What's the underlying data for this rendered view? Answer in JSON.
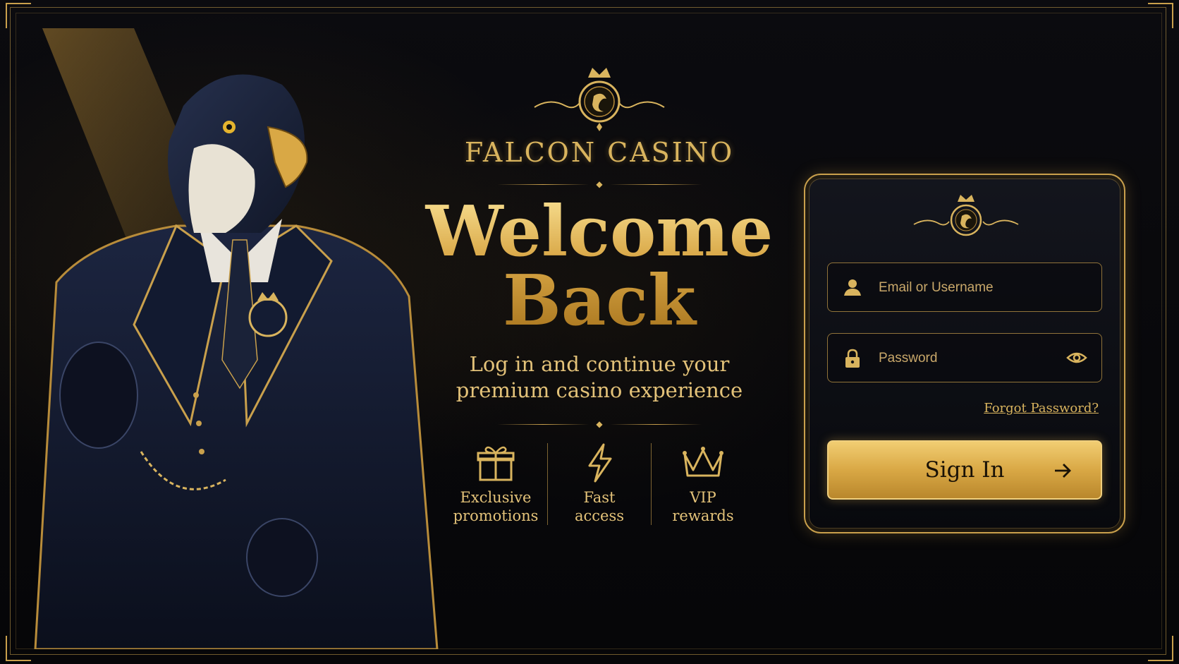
{
  "brand": {
    "name": "FALCON CASINO"
  },
  "hero": {
    "title_line1": "Welcome",
    "title_line2": "Back",
    "subtitle_line1": "Log in and continue your",
    "subtitle_line2": "premium casino experience"
  },
  "features": [
    {
      "icon": "gift-icon",
      "line1": "Exclusive",
      "line2": "promotions"
    },
    {
      "icon": "lightning-icon",
      "line1": "Fast",
      "line2": "access"
    },
    {
      "icon": "crown-icon",
      "line1": "VIP",
      "line2": "rewards"
    }
  ],
  "login": {
    "email_placeholder": "Email or Username",
    "password_placeholder": "Password",
    "forgot_label": "Forgot Password?",
    "signin_label": "Sign In"
  },
  "colors": {
    "gold": "#d9b45e",
    "gold_light": "#f1cd72",
    "background": "#07070a",
    "navy": "#141c33"
  }
}
